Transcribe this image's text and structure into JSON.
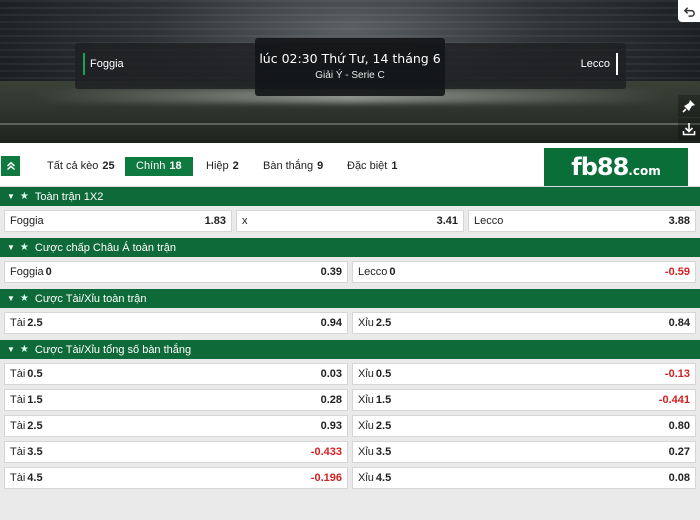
{
  "match": {
    "home": "Foggia",
    "away": "Lecco",
    "time": "lúc 02:30 Thứ Tư, 14 tháng 6",
    "league": "Giải Ý - Serie C"
  },
  "icons": {
    "undo": "undo-icon",
    "pin": "pin-icon",
    "download": "download-icon",
    "collapse": "chevron-double-up-icon"
  },
  "tabs": [
    {
      "label": "Tất cả kèo",
      "count": "25"
    },
    {
      "label": "Chính",
      "count": "18"
    },
    {
      "label": "Hiệp",
      "count": "2"
    },
    {
      "label": "Bàn thắng",
      "count": "9"
    },
    {
      "label": "Đặc biệt",
      "count": "1"
    }
  ],
  "logo": {
    "main": "fb88",
    "suffix": ".com"
  },
  "colors": {
    "accent": "#0e7a40",
    "section": "#0e6a38",
    "negative": "#d32020"
  },
  "sections": [
    {
      "title": "Toàn trận 1X2",
      "rows": [
        [
          {
            "label": "Foggia",
            "line": "",
            "odd": "1.83"
          },
          {
            "label": "x",
            "line": "",
            "odd": "3.41"
          },
          {
            "label": "Lecco",
            "line": "",
            "odd": "3.88"
          }
        ]
      ]
    },
    {
      "title": "Cược chấp Châu Á toàn trận",
      "rows": [
        [
          {
            "label": "Foggia",
            "line": "0",
            "odd": "0.39"
          },
          {
            "label": "Lecco",
            "line": "0",
            "odd": "-0.59"
          }
        ]
      ]
    },
    {
      "title": "Cược Tài/Xỉu toàn trận",
      "rows": [
        [
          {
            "label": "Tài",
            "line": "2.5",
            "odd": "0.94"
          },
          {
            "label": "Xỉu",
            "line": "2.5",
            "odd": "0.84"
          }
        ]
      ]
    },
    {
      "title": "Cược Tài/Xỉu tổng số bàn thắng",
      "rows": [
        [
          {
            "label": "Tài",
            "line": "0.5",
            "odd": "0.03"
          },
          {
            "label": "Xỉu",
            "line": "0.5",
            "odd": "-0.13"
          }
        ],
        [
          {
            "label": "Tài",
            "line": "1.5",
            "odd": "0.28"
          },
          {
            "label": "Xỉu",
            "line": "1.5",
            "odd": "-0.441"
          }
        ],
        [
          {
            "label": "Tài",
            "line": "2.5",
            "odd": "0.93"
          },
          {
            "label": "Xỉu",
            "line": "2.5",
            "odd": "0.80"
          }
        ],
        [
          {
            "label": "Tài",
            "line": "3.5",
            "odd": "-0.433"
          },
          {
            "label": "Xỉu",
            "line": "3.5",
            "odd": "0.27"
          }
        ],
        [
          {
            "label": "Tài",
            "line": "4.5",
            "odd": "-0.196"
          },
          {
            "label": "Xỉu",
            "line": "4.5",
            "odd": "0.08"
          }
        ]
      ]
    }
  ]
}
